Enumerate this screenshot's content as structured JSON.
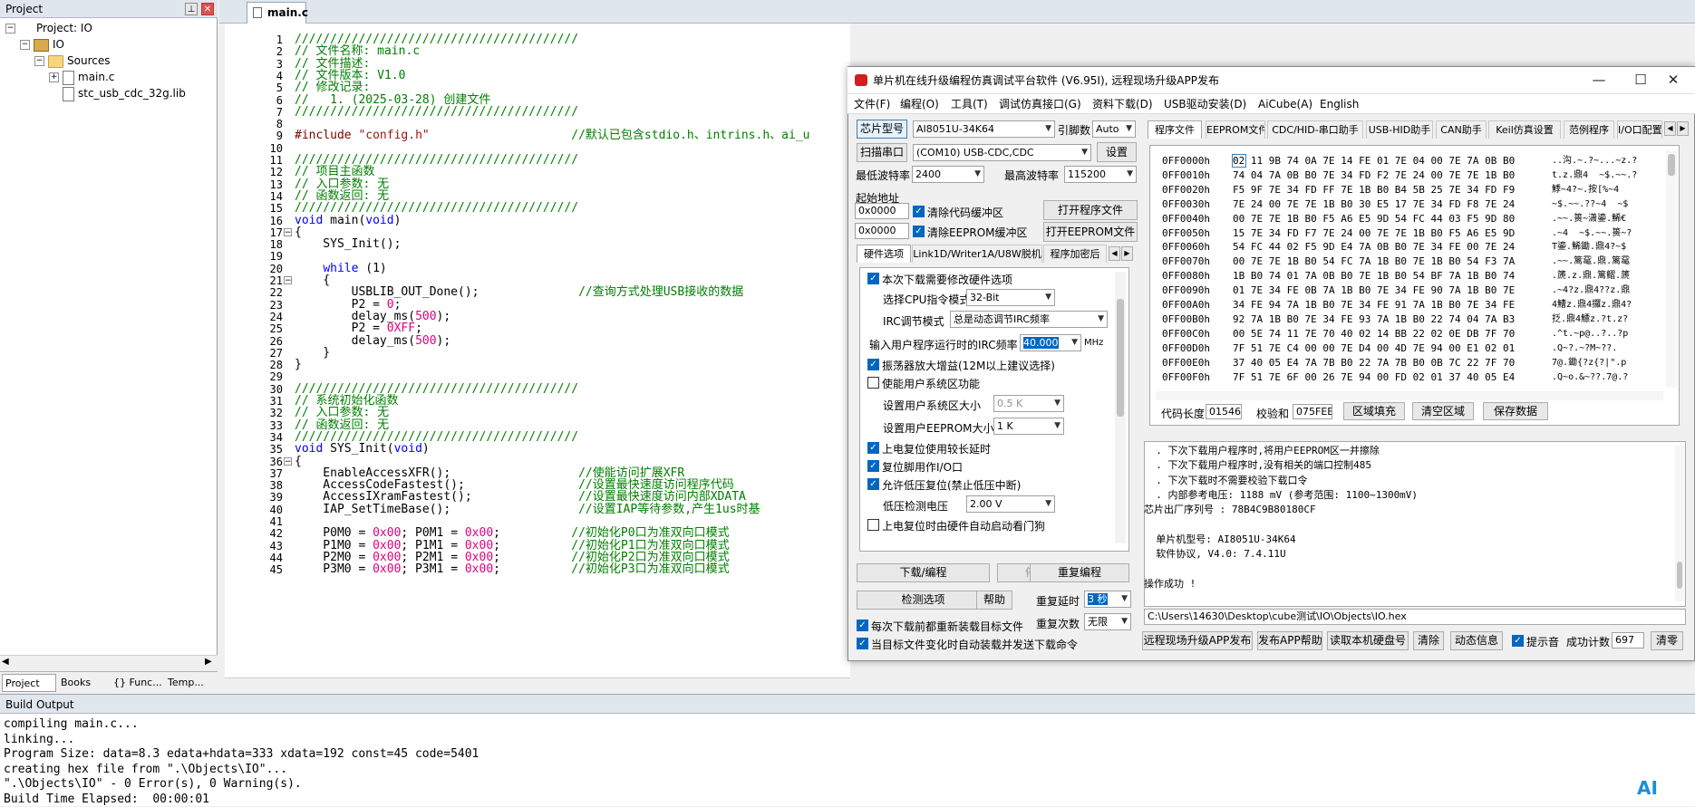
{
  "project": {
    "title": "Project",
    "tree": [
      {
        "label": "Project: IO",
        "level": 0,
        "expander": "−",
        "icon": "project"
      },
      {
        "label": "IO",
        "level": 1,
        "expander": "−",
        "icon": "target"
      },
      {
        "label": "Sources",
        "level": 2,
        "expander": "−",
        "icon": "folder"
      },
      {
        "label": "main.c",
        "level": 3,
        "expander": "+",
        "icon": "file"
      },
      {
        "label": "stc_usb_cdc_32g.lib",
        "level": 3,
        "expander": "",
        "icon": "file"
      }
    ],
    "tabs": [
      "Project",
      "Books",
      "{} Func...",
      "Temp..."
    ]
  },
  "editor": {
    "tab": "main.c",
    "lines": [
      {
        "n": "1",
        "code": [
          [
            "c",
            "////////////////////////////////////////"
          ]
        ]
      },
      {
        "n": "2",
        "code": [
          [
            "c",
            "// 文件名称: main.c"
          ]
        ]
      },
      {
        "n": "3",
        "code": [
          [
            "c",
            "// 文件描述:"
          ]
        ]
      },
      {
        "n": "4",
        "code": [
          [
            "c",
            "// 文件版本: V1.0"
          ]
        ]
      },
      {
        "n": "5",
        "code": [
          [
            "c",
            "// 修改记录:"
          ]
        ]
      },
      {
        "n": "6",
        "code": [
          [
            "c",
            "//   1. (2025-03-28) 创建文件"
          ]
        ]
      },
      {
        "n": "7",
        "code": [
          [
            "c",
            "////////////////////////////////////////"
          ]
        ]
      },
      {
        "n": "8",
        "code": []
      },
      {
        "n": "9",
        "code": [
          [
            "p",
            "#include "
          ],
          [
            "s",
            "\"config.h\""
          ],
          [
            "t",
            "                    "
          ],
          [
            "c",
            "//默认已包含stdio.h、intrins.h、ai_u"
          ]
        ]
      },
      {
        "n": "10",
        "code": []
      },
      {
        "n": "11",
        "code": [
          [
            "c",
            "////////////////////////////////////////"
          ]
        ]
      },
      {
        "n": "12",
        "code": [
          [
            "c",
            "// 项目主函数"
          ]
        ]
      },
      {
        "n": "13",
        "code": [
          [
            "c",
            "// 入口参数: 无"
          ]
        ]
      },
      {
        "n": "14",
        "code": [
          [
            "c",
            "// 函数返回: 无"
          ]
        ]
      },
      {
        "n": "15",
        "code": [
          [
            "c",
            "////////////////////////////////////////"
          ]
        ]
      },
      {
        "n": "16",
        "code": [
          [
            "k",
            "void"
          ],
          [
            "t",
            " main("
          ],
          [
            "k",
            "void"
          ],
          [
            "t",
            ")"
          ]
        ]
      },
      {
        "n": "17",
        "code": [
          [
            "t",
            "{"
          ]
        ],
        "fold": "−"
      },
      {
        "n": "18",
        "code": [
          [
            "t",
            "    SYS_Init();"
          ]
        ]
      },
      {
        "n": "19",
        "code": []
      },
      {
        "n": "20",
        "code": [
          [
            "t",
            "    "
          ],
          [
            "k",
            "while"
          ],
          [
            "t",
            " (1)"
          ]
        ]
      },
      {
        "n": "21",
        "code": [
          [
            "t",
            "    {"
          ]
        ],
        "fold": "−"
      },
      {
        "n": "22",
        "code": [
          [
            "t",
            "        USBLIB_OUT_Done();              "
          ],
          [
            "c",
            "//查询方式处理USB接收的数据"
          ]
        ]
      },
      {
        "n": "23",
        "code": [
          [
            "t",
            "        P2 = "
          ],
          [
            "n",
            "0"
          ],
          [
            "t",
            ";"
          ]
        ]
      },
      {
        "n": "24",
        "code": [
          [
            "t",
            "        delay_ms("
          ],
          [
            "n",
            "500"
          ],
          [
            "t",
            ");"
          ]
        ]
      },
      {
        "n": "25",
        "code": [
          [
            "t",
            "        P2 = "
          ],
          [
            "n",
            "0XFF"
          ],
          [
            "t",
            ";"
          ]
        ]
      },
      {
        "n": "26",
        "code": [
          [
            "t",
            "        delay_ms("
          ],
          [
            "n",
            "500"
          ],
          [
            "t",
            ");"
          ]
        ]
      },
      {
        "n": "27",
        "code": [
          [
            "t",
            "    }"
          ]
        ]
      },
      {
        "n": "28",
        "code": [
          [
            "t",
            "}"
          ]
        ]
      },
      {
        "n": "29",
        "code": []
      },
      {
        "n": "30",
        "code": [
          [
            "c",
            "////////////////////////////////////////"
          ]
        ]
      },
      {
        "n": "31",
        "code": [
          [
            "c",
            "// 系统初始化函数"
          ]
        ]
      },
      {
        "n": "32",
        "code": [
          [
            "c",
            "// 入口参数: 无"
          ]
        ]
      },
      {
        "n": "33",
        "code": [
          [
            "c",
            "// 函数返回: 无"
          ]
        ]
      },
      {
        "n": "34",
        "code": [
          [
            "c",
            "////////////////////////////////////////"
          ]
        ]
      },
      {
        "n": "35",
        "code": [
          [
            "k",
            "void"
          ],
          [
            "t",
            " SYS_Init("
          ],
          [
            "k",
            "void"
          ],
          [
            "t",
            ")"
          ]
        ]
      },
      {
        "n": "36",
        "code": [
          [
            "t",
            "{"
          ]
        ],
        "fold": "−"
      },
      {
        "n": "37",
        "code": [
          [
            "t",
            "    EnableAccessXFR();                  "
          ],
          [
            "c",
            "//使能访问扩展XFR"
          ]
        ]
      },
      {
        "n": "38",
        "code": [
          [
            "t",
            "    AccessCodeFastest();                "
          ],
          [
            "c",
            "//设置最快速度访问程序代码"
          ]
        ]
      },
      {
        "n": "39",
        "code": [
          [
            "t",
            "    AccessIXramFastest();               "
          ],
          [
            "c",
            "//设置最快速度访问内部XDATA"
          ]
        ]
      },
      {
        "n": "40",
        "code": [
          [
            "t",
            "    IAP_SetTimeBase();                  "
          ],
          [
            "c",
            "//设置IAP等待参数,产生1us时基"
          ]
        ]
      },
      {
        "n": "41",
        "code": []
      },
      {
        "n": "42",
        "code": [
          [
            "t",
            "    P0M0 = "
          ],
          [
            "n",
            "0x00"
          ],
          [
            "t",
            "; P0M1 = "
          ],
          [
            "n",
            "0x00"
          ],
          [
            "t",
            ";          "
          ],
          [
            "c",
            "//初始化P0口为准双向口模式"
          ]
        ]
      },
      {
        "n": "43",
        "code": [
          [
            "t",
            "    P1M0 = "
          ],
          [
            "n",
            "0x00"
          ],
          [
            "t",
            "; P1M1 = "
          ],
          [
            "n",
            "0x00"
          ],
          [
            "t",
            ";          "
          ],
          [
            "c",
            "//初始化P1口为准双向口模式"
          ]
        ]
      },
      {
        "n": "44",
        "code": [
          [
            "t",
            "    P2M0 = "
          ],
          [
            "n",
            "0x00"
          ],
          [
            "t",
            "; P2M1 = "
          ],
          [
            "n",
            "0x00"
          ],
          [
            "t",
            ";          "
          ],
          [
            "c",
            "//初始化P2口为准双向口模式"
          ]
        ]
      },
      {
        "n": "45",
        "code": [
          [
            "t",
            "    P3M0 = "
          ],
          [
            "n",
            "0x00"
          ],
          [
            "t",
            "; P3M1 = "
          ],
          [
            "n",
            "0x00"
          ],
          [
            "t",
            ";          "
          ],
          [
            "c",
            "//初始化P3口为准双向口模式"
          ]
        ]
      }
    ]
  },
  "build": {
    "title": "Build Output",
    "lines": [
      "compiling main.c...",
      "linking...",
      "Program Size: data=8.3 edata+hdata=333 xdata=192 const=45 code=5401",
      "creating hex file from \".\\Objects\\IO\"...",
      "\".\\Objects\\IO\" - 0 Error(s), 0 Warning(s).",
      "Build Time Elapsed:  00:00:01"
    ]
  },
  "isp": {
    "title": "单片机在线升级编程仿真调试平台软件 (V6.95I), 远程现场升级APP发布",
    "menu": [
      "文件(F)",
      "编程(O)",
      "工具(T)",
      "调试仿真接口(G)",
      "资料下载(D)",
      "USB驱动安装(D)",
      "AiCube(A)",
      "English"
    ],
    "chip_btn": "芯片型号",
    "chip_value": "AI8051U-34K64",
    "pin_label": "引脚数",
    "pin_value": "Auto",
    "scan_btn": "扫描串口",
    "port_value": "(COM10) USB-CDC,CDC",
    "settings_btn": "设置",
    "min_baud_label": "最低波特率",
    "min_baud_value": "2400",
    "max_baud_label": "最高波特率",
    "max_baud_value": "115200",
    "start_addr_label": "起始地址",
    "addr1": "0x0000",
    "addr2": "0x0000",
    "clear_code_cb": "清除代码缓冲区",
    "clear_eeprom_cb": "清除EEPROM缓冲区",
    "open_prog_btn": "打开程序文件",
    "open_eeprom_btn": "打开EEPROM文件",
    "left_tabs": [
      "硬件选项",
      "Link1D/Writer1A/U8W脱机",
      "程序加密后"
    ],
    "hw": {
      "opt_modify": "本次下载需要修改硬件选项",
      "cpu_mode_label": "选择CPU指令模式",
      "cpu_mode_value": "32-Bit",
      "irc_mode_label": "IRC调节模式",
      "irc_mode_value": "总是动态调节IRC频率",
      "irc_freq_label": "输入用户程序运行时的IRC频率",
      "irc_freq_value": "40.000",
      "irc_unit": "MHz",
      "osc_gain": "振荡器放大增益(12M以上建议选择)",
      "user_sys": "使能用户系统区功能",
      "user_sys_size_label": "设置用户系统区大小",
      "user_sys_size_value": "0.5 K",
      "user_eeprom_label": "设置用户EEPROM大小",
      "user_eeprom_value": "1   K",
      "long_delay": "上电复位使用较长延时",
      "reset_io": "复位脚用作I/O口",
      "lvr": "允许低压复位(禁止低压中断)",
      "lvd_label": "低压检测电压",
      "lvd_value": "2.00 V",
      "wdt": "上电复位时由硬件自动启动看门狗"
    },
    "download_btn": "下载/编程",
    "stop_btn": "停止",
    "reprogram_btn": "重复编程",
    "check_btn": "检测选项",
    "help_btn": "帮助",
    "repeat_delay_label": "重复延时",
    "repeat_delay_value": "3 秒",
    "repeat_count_label": "重复次数",
    "repeat_count_value": "无限",
    "reload_cb": "每次下载前都重新装载目标文件",
    "auto_cb": "当目标文件变化时自动装载并发送下载命令",
    "right_tabs": [
      "程序文件",
      "EEPROM文件",
      "CDC/HID-串口助手",
      "USB-HID助手",
      "CAN助手",
      "Keil仿真设置",
      "范例程序",
      "I/O口配置"
    ],
    "hex": [
      {
        "a": "0FF0000h",
        "b": "02 11 9B 74 0A 7E 14 FE 01 7E 04 00 7E 7A 0B B0",
        "t": " ..沟.~.?~...~z.?"
      },
      {
        "a": "0FF0010h",
        "b": "74 04 7A 0B B0 7E 34 FD F2 7E 24 00 7E 7E 1B B0",
        "t": " t.z.鼎4  ~$.~~.?"
      },
      {
        "a": "0FF0020h",
        "b": "F5 9F 7E 34 FD FF 7E 1B B0 B4 5B 25 7E 34 FD F9",
        "t": " 鯚~4?~.按[%~4"
      },
      {
        "a": "0FF0030h",
        "b": "7E 24 00 7E 7E 1B B0 30 E5 17 7E 34 FD F8 7E 24",
        "t": " ~$.~~.??~4  ~$"
      },
      {
        "a": "0FF0040h",
        "b": "00 7E 7E 1B B0 F5 A6 E5 9D 54 FC 44 03 F5 9D 80",
        "t": " .~~.篑~潇鎏.鯑€"
      },
      {
        "a": "0FF0050h",
        "b": "15 7E 34 FD F7 7E 24 00 7E 7E 1B B0 F5 A6 E5 9D",
        "t": " .~4  ~$.~~.篑~?"
      },
      {
        "a": "0FF0060h",
        "b": "54 FC 44 02 F5 9D E4 7A 0B B0 7E 34 FE 00 7E 24",
        "t": " T鎏.鯑鋤.鼎4?~$"
      },
      {
        "a": "0FF0070h",
        "b": "00 7E 7E 1B B0 54 FC 7A 1B B0 7E 1B B0 54 F3 7A",
        "t": " .~~.篱鼋.鼎.篱鼋"
      },
      {
        "a": "0FF0080h",
        "b": "1B B0 74 01 7A 0B B0 7E 1B B0 54 BF 7A 1B B0 74",
        "t": " .篪.z.鼎.篱鳛.篪"
      },
      {
        "a": "0FF0090h",
        "b": "01 7E 34 FE 0B 7A 1B B0 7E 34 FE 90 7A 1B B0 7E",
        "t": " .~4?z.鼎4??z.鼎"
      },
      {
        "a": "0FF00A0h",
        "b": "34 FE 94 7A 1B B0 7E 34 FE 91 7A 1B B0 7E 34 FE",
        "t": " 4鰽z.鼎4攞z.鼎4?"
      },
      {
        "a": "0FF00B0h",
        "b": "92 7A 1B B0 7E 34 FE 93 7A 1B B0 22 74 04 7A B3",
        "t": " 抸.鼎4鰾z.?t.z?"
      },
      {
        "a": "0FF00C0h",
        "b": "00 5E 74 11 7E 70 40 02 14 BB 22 02 0E DB 7F 70",
        "t": " .^t.~p@..?..?p"
      },
      {
        "a": "0FF00D0h",
        "b": "7F 51 7E C4 00 00 7E D4 00 4D 7E 94 00 E1 02 01",
        "t": " .Q~?.~?M~??."
      },
      {
        "a": "0FF00E0h",
        "b": "37 40 05 E4 7A 7B B0 22 7A 7B B0 0B 7C 22 7F 70",
        "t": " 7@.鋤{?z{?|\".p"
      },
      {
        "a": "0FF00F0h",
        "b": "7F 51 7E 6F 00 26 7E 94 00 FD 02 01 37 40 05 E4",
        "t": " .Q~o.&~??.7@.?"
      }
    ],
    "code_len_label": "代码长度",
    "code_len_value": "01546",
    "checksum_label": "校验和",
    "checksum_value": "075FEB",
    "fill_btn": "区域填充",
    "clear_area_btn": "清空区域",
    "save_btn": "保存数据",
    "info_lines": [
      "  . 下次下载用户程序时,将用户EEPROM区一并擦除",
      "  . 下次下载用户程序时,没有相关的端口控制485",
      "  . 下次下载时不需要校验下载口令",
      "  . 内部参考电压: 1188 mV (参考范围: 1100~1300mV)",
      "芯片出厂序列号 : 78B4C9B80180CF",
      "",
      "  单片机型号: AI8051U-34K64",
      "  软件协议, V4.0: 7.4.11U",
      "",
      "操作成功 !"
    ],
    "path": "C:\\Users\\14630\\Desktop\\cube测试\\IO\\Objects\\IO.hex",
    "remote_btn": "远程现场升级APP发布",
    "publish_help_btn": "发布APP帮助",
    "read_disk_btn": "读取本机硬盘号",
    "clear_btn": "清除",
    "dynamic_btn": "动态信息",
    "tip_cb": "提示音",
    "success_label": "成功计数",
    "success_value": "697",
    "clear2_btn": "清零"
  },
  "ai_logo": "AI"
}
